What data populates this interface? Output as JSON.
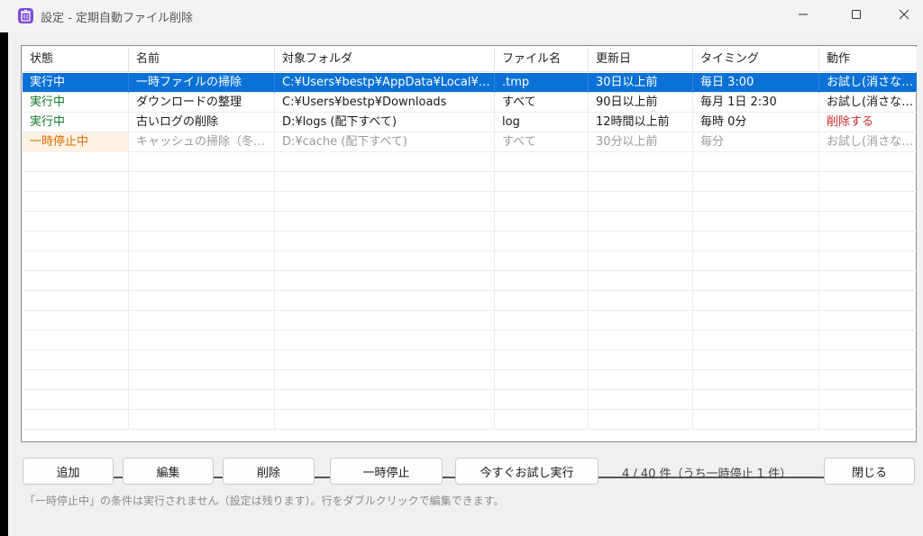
{
  "window": {
    "title": "設定 - 定期自動ファイル削除",
    "app_icon": "trash-icon",
    "controls": {
      "minimize": "minimize-icon",
      "maximize": "maximize-icon",
      "close": "close-icon"
    }
  },
  "table": {
    "headers": [
      "状態",
      "名前",
      "対象フォルダ",
      "ファイル名",
      "更新日",
      "タイミング",
      "動作"
    ],
    "rows": [
      {
        "state": "実行中",
        "name": "一時ファイルの掃除",
        "folder": "C:¥Users¥bestp¥AppData¥Local¥Te...",
        "file": ".tmp",
        "updated": "30日以上前",
        "timing": "毎日 3:00",
        "action": "お試し(消さない)"
      },
      {
        "state": "実行中",
        "name": "ダウンロードの整理",
        "folder": "C:¥Users¥bestp¥Downloads",
        "file": "すべて",
        "updated": "90日以上前",
        "timing": "毎月 1日 2:30",
        "action": "お試し(消さない)"
      },
      {
        "state": "実行中",
        "name": "古いログの削除",
        "folder": "D:¥logs (配下すべて)",
        "file": "log",
        "updated": "12時間以上前",
        "timing": "毎時 0分",
        "action": "削除する"
      },
      {
        "state": "一時停止中",
        "name": "キャッシュの掃除（冬期...",
        "folder": "D:¥cache (配下すべて)",
        "file": "すべて",
        "updated": "30分以上前",
        "timing": "毎分",
        "action": "お試し(消さない)"
      }
    ]
  },
  "buttons": {
    "add": "追加",
    "edit": "編集",
    "delete": "削除",
    "pause": "一時停止",
    "trial_run": "今すぐお試し実行",
    "close": "閉じる"
  },
  "status": {
    "count": "4 / 40 件（うち一時停止 1 件）",
    "hint": "「一時停止中」の条件は実行されません（設定は残ります）。行をダブルクリックで編集できます。"
  },
  "colors": {
    "selection": "#0a72d6",
    "running": "#167a2c",
    "paused": "#d97000",
    "delete_action": "#cc2a2a"
  }
}
